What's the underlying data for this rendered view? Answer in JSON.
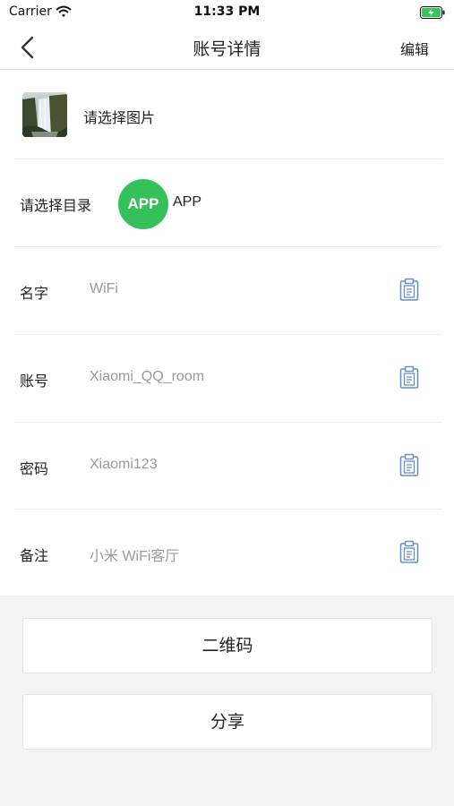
{
  "status_bar": {
    "carrier": "Carrier",
    "time": "11:33 PM",
    "wifi_icon": "wifi-icon",
    "battery_icon": "battery-charging-icon",
    "battery_color": "#34c759"
  },
  "nav": {
    "back_icon": "chevron-left-icon",
    "title": "账号详情",
    "edit_label": "编辑"
  },
  "image_row": {
    "thumbnail": "waterfall-image",
    "label": "请选择图片"
  },
  "directory_row": {
    "label": "请选择目录",
    "badge_text": "APP",
    "badge_color": "#35c15a",
    "name": "APP"
  },
  "fields": [
    {
      "label": "名字",
      "value": "WiFi",
      "icon": "clipboard-icon"
    },
    {
      "label": "账号",
      "value": "Xiaomi_QQ_room",
      "icon": "clipboard-icon"
    },
    {
      "label": "密码",
      "value": "Xiaomi123",
      "icon": "clipboard-icon"
    },
    {
      "label": "备注",
      "value": "小米 WiFi客厅",
      "icon": "clipboard-icon"
    }
  ],
  "actions": {
    "qr_label": "二维码",
    "share_label": "分享"
  },
  "colors": {
    "icon_blue": "#6b8fc6",
    "value_gray": "#9a9a9a"
  }
}
